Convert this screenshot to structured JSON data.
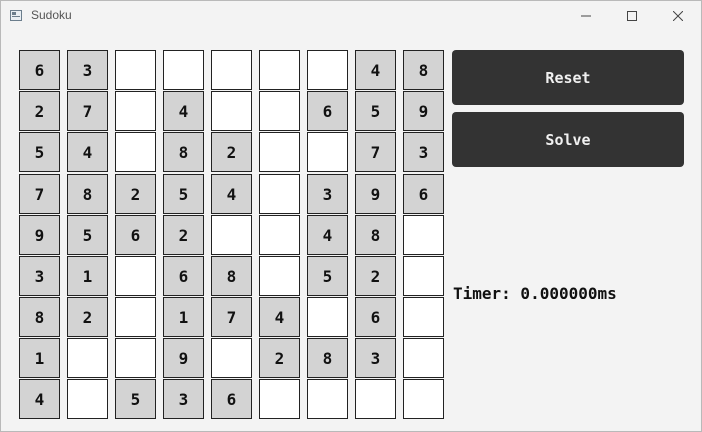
{
  "window": {
    "title": "Sudoku"
  },
  "grid": {
    "rows": [
      [
        "6",
        "3",
        "",
        "",
        "",
        "",
        "",
        "4",
        "8"
      ],
      [
        "2",
        "7",
        "",
        "4",
        "",
        "",
        "6",
        "5",
        "9"
      ],
      [
        "5",
        "4",
        "",
        "8",
        "2",
        "",
        "",
        "7",
        "3"
      ],
      [
        "7",
        "8",
        "2",
        "5",
        "4",
        "",
        "3",
        "9",
        "6"
      ],
      [
        "9",
        "5",
        "6",
        "2",
        "",
        "",
        "4",
        "8",
        ""
      ],
      [
        "3",
        "1",
        "",
        "6",
        "8",
        "",
        "5",
        "2",
        ""
      ],
      [
        "8",
        "2",
        "",
        "1",
        "7",
        "4",
        "",
        "6",
        ""
      ],
      [
        "1",
        "",
        "",
        "9",
        "",
        "2",
        "8",
        "3",
        ""
      ],
      [
        "4",
        "",
        "5",
        "3",
        "6",
        "",
        "",
        "",
        ""
      ]
    ]
  },
  "controls": {
    "reset_label": "Reset",
    "solve_label": "Solve",
    "timer_text": "Timer: 0.000000ms"
  },
  "colors": {
    "given_cell": "#d3d3d3",
    "empty_cell": "#ffffff",
    "button_bg": "#333333",
    "button_text": "#f0f0f0"
  },
  "icons": {
    "app": "window-app-icon",
    "minimize": "minimize-icon",
    "maximize": "maximize-icon",
    "close": "close-icon"
  }
}
